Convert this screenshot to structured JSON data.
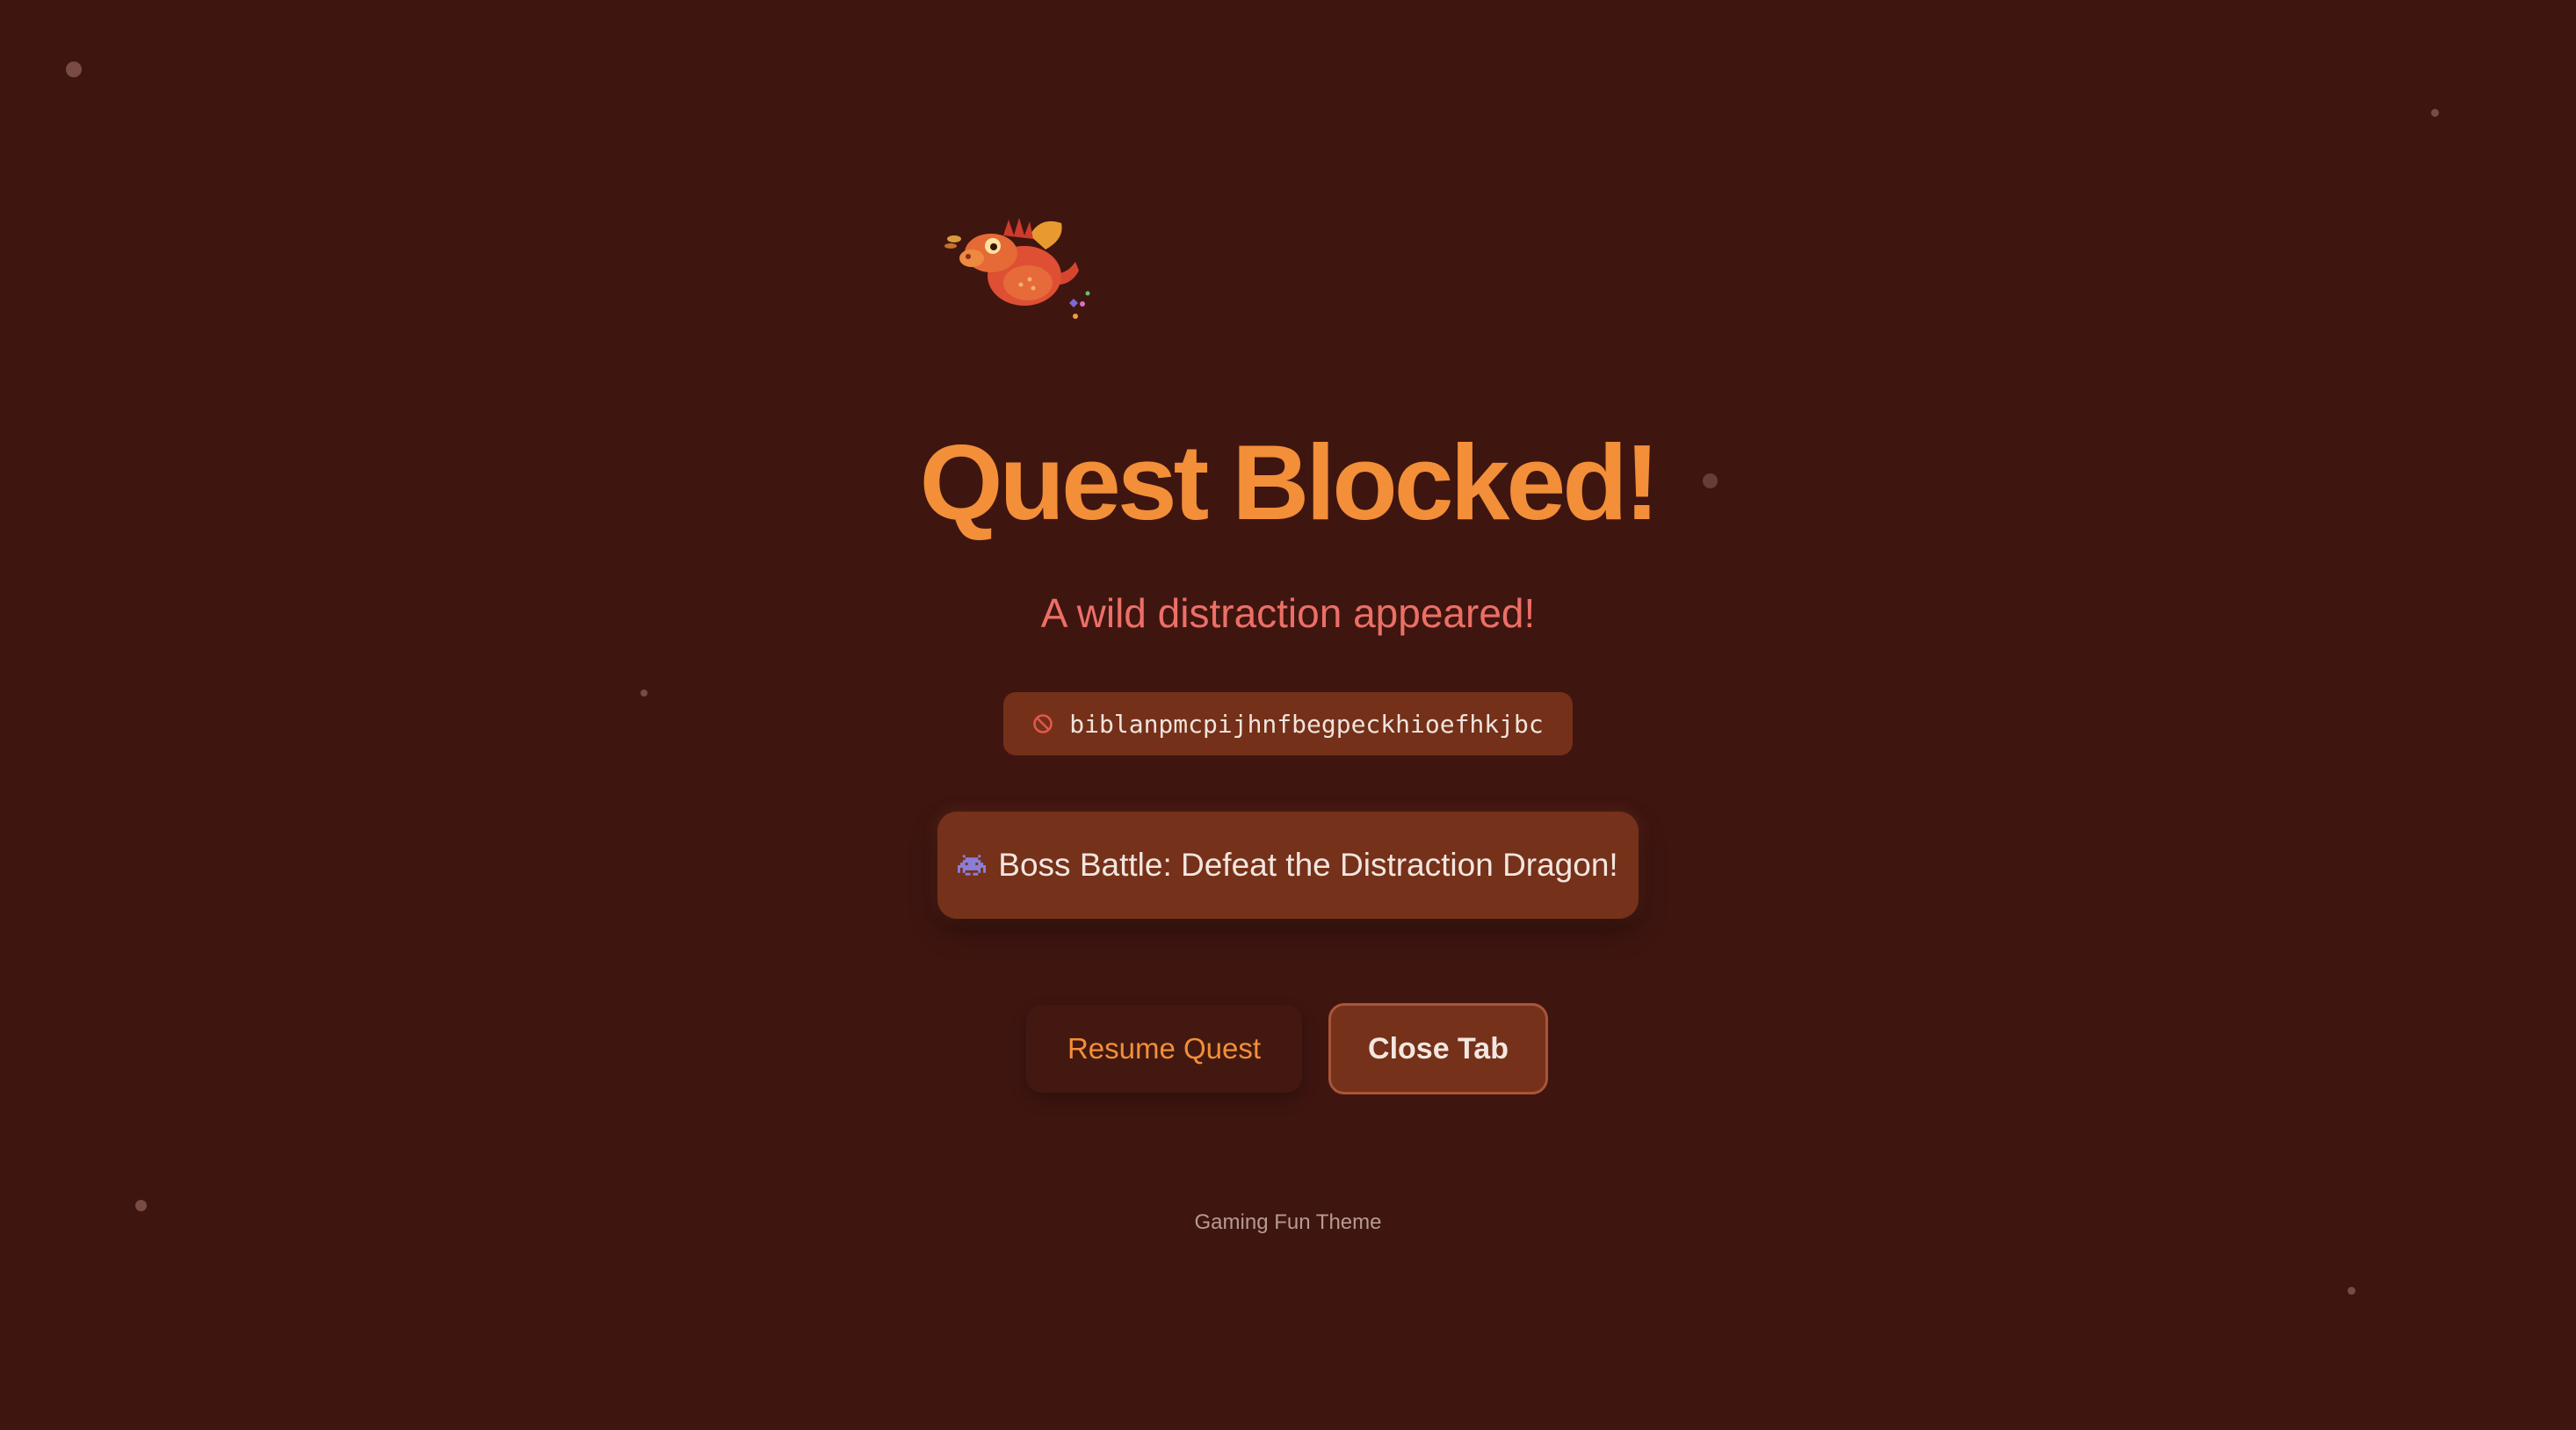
{
  "icons": {
    "dragon": "dragon-icon",
    "blocked": "no-entry-icon",
    "boss": "alien-monster-icon"
  },
  "colors": {
    "background": "#3f1510",
    "title": "#f28f38",
    "subtitle": "#ec6f66",
    "card": "#753119"
  },
  "hero": {
    "title": "Quest Blocked!",
    "subtitle": "A wild distraction appeared!"
  },
  "blocked_site": {
    "url": "biblanpmcpijhnfbegpeckhioefhkjbc"
  },
  "boss_battle": {
    "label": "Boss Battle: Defeat the Distraction Dragon!"
  },
  "actions": {
    "resume_label": "Resume Quest",
    "close_label": "Close Tab"
  },
  "footer": {
    "theme_label": "Gaming Fun Theme"
  }
}
